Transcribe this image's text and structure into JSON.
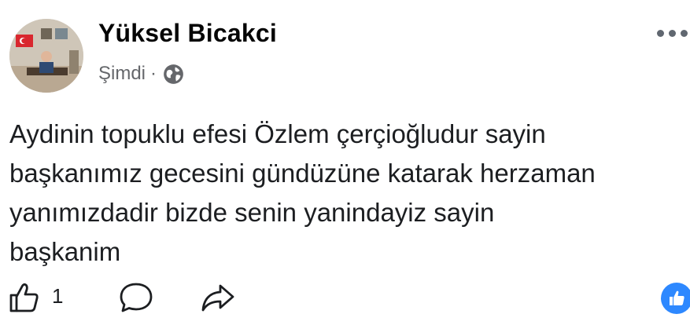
{
  "post": {
    "author": "Yüksel Bicakci",
    "timestamp": "Şimdi",
    "separator": "·",
    "audience_icon": "globe-icon",
    "menu_icon": "more-options-icon",
    "text": "Aydinin topuklu efesi Özlem çerçioğludur sayin\nbaşkanımız gecesini gündüzüne katarak herzaman\nyanımızdadir bizde senin yanindayiz sayin\nbaşkanim"
  },
  "actions": {
    "like_icon": "thumbs-up-icon",
    "like_count": "1",
    "comment_icon": "comment-icon",
    "share_icon": "share-icon",
    "reaction_icon": "like-reaction-icon"
  },
  "colors": {
    "meta_gray": "#65676b",
    "text": "#1c1e21",
    "reaction_blue": "#2d88ff"
  }
}
